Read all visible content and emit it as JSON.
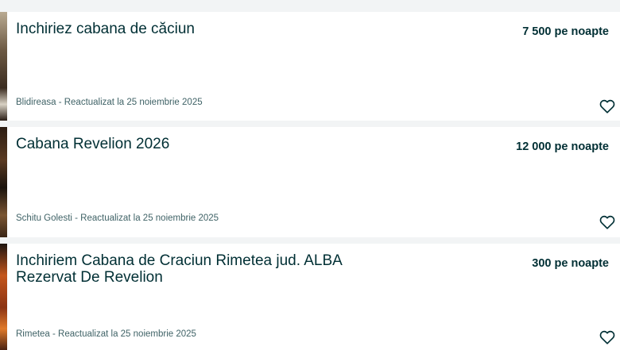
{
  "listings": [
    {
      "title": "Inchiriez cabana de căciun",
      "price": "7 500 pe noapte",
      "location_date": "Blidireasa - Reactualizat la 25 noiembrie 2025",
      "favorite_icon": "heart-outline-icon"
    },
    {
      "title": "Cabana Revelion 2026",
      "price": "12 000 pe noapte",
      "location_date": "Schitu Golesti - Reactualizat la 25 noiembrie 2025",
      "favorite_icon": "heart-outline-icon"
    },
    {
      "title": "Inchiriem Cabana de Craciun Rimetea jud. ALBA Rezervat De Revelion",
      "price": "300 pe noapte",
      "location_date": "Rimetea - Reactualizat la 25 noiembrie 2025",
      "favorite_icon": "heart-outline-icon"
    }
  ],
  "colors": {
    "text_primary": "#002f34",
    "text_secondary": "#406367",
    "background": "#f2f4f5",
    "card": "#ffffff"
  }
}
